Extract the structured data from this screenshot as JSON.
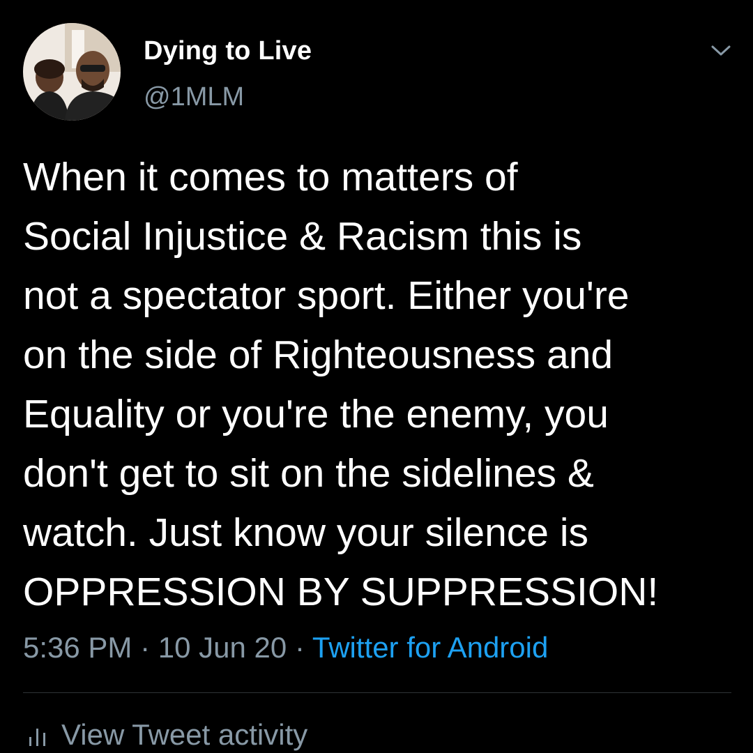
{
  "author": {
    "display_name": "Dying to Live",
    "handle": "@1MLM"
  },
  "tweet": {
    "lines": [
      "When it comes to matters of",
      "Social Injustice & Racism this is",
      "not a spectator sport. Either you're",
      "on the side of Righteousness and",
      "Equality or you're the enemy, you",
      "don't get to sit on the sidelines &",
      "watch. Just know your silence is",
      "OPPRESSION BY SUPPRESSION!"
    ],
    "time": "5:36 PM",
    "date": "10 Jun 20",
    "separator": "·",
    "source": "Twitter for Android"
  },
  "activity": {
    "label": "View Tweet activity",
    "icon": "bar-chart-icon"
  },
  "colors": {
    "background": "#000000",
    "text": "#ffffff",
    "muted": "#8899a6",
    "link": "#1da1f2",
    "divider": "#2f3336"
  },
  "icons": {
    "menu": "chevron-down-icon"
  }
}
